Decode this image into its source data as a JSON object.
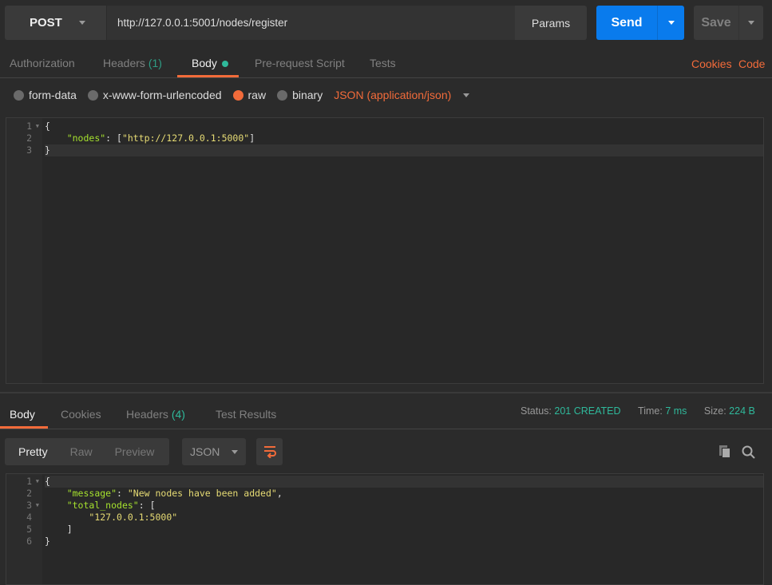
{
  "request": {
    "method": "POST",
    "url": "http://127.0.0.1:5001/nodes/register",
    "params_label": "Params",
    "send_label": "Send",
    "save_label": "Save"
  },
  "request_tabs": {
    "authorization": "Authorization",
    "headers": "Headers",
    "headers_count": "(1)",
    "body": "Body",
    "pre_request": "Pre-request Script",
    "tests": "Tests",
    "cookies": "Cookies",
    "code": "Code"
  },
  "body_types": {
    "form_data": "form-data",
    "urlencoded": "x-www-form-urlencoded",
    "raw": "raw",
    "binary": "binary",
    "content_type": "JSON (application/json)",
    "selected": "raw"
  },
  "request_body": {
    "line_numbers": [
      "1",
      "2",
      "3"
    ],
    "lines": [
      [
        "{"
      ],
      [
        "    ",
        "\"nodes\"",
        ": [",
        "\"http://127.0.0.1:5000\"",
        "]"
      ],
      [
        "}"
      ]
    ]
  },
  "response_tabs": {
    "body": "Body",
    "cookies": "Cookies",
    "headers": "Headers",
    "headers_count": "(4)",
    "test_results": "Test Results"
  },
  "response_status": {
    "status_label": "Status:",
    "status": "201 CREATED",
    "time_label": "Time:",
    "time": "7 ms",
    "size_label": "Size:",
    "size": "224 B"
  },
  "response_view": {
    "pretty": "Pretty",
    "raw": "Raw",
    "preview": "Preview",
    "format": "JSON"
  },
  "response_body": {
    "line_numbers": [
      "1",
      "2",
      "3",
      "4",
      "5",
      "6"
    ],
    "l1": "{",
    "l2_key": "\"message\"",
    "l2_sep": ": ",
    "l2_val": "\"New nodes have been added\"",
    "l2_end": ",",
    "l3_key": "\"total_nodes\"",
    "l3_sep": ": [",
    "l4_val": "\"127.0.0.1:5000\"",
    "l5": "]",
    "l6": "}"
  },
  "colors": {
    "accent": "#f26b3a",
    "send": "#097bed",
    "success": "#2fb99b"
  }
}
